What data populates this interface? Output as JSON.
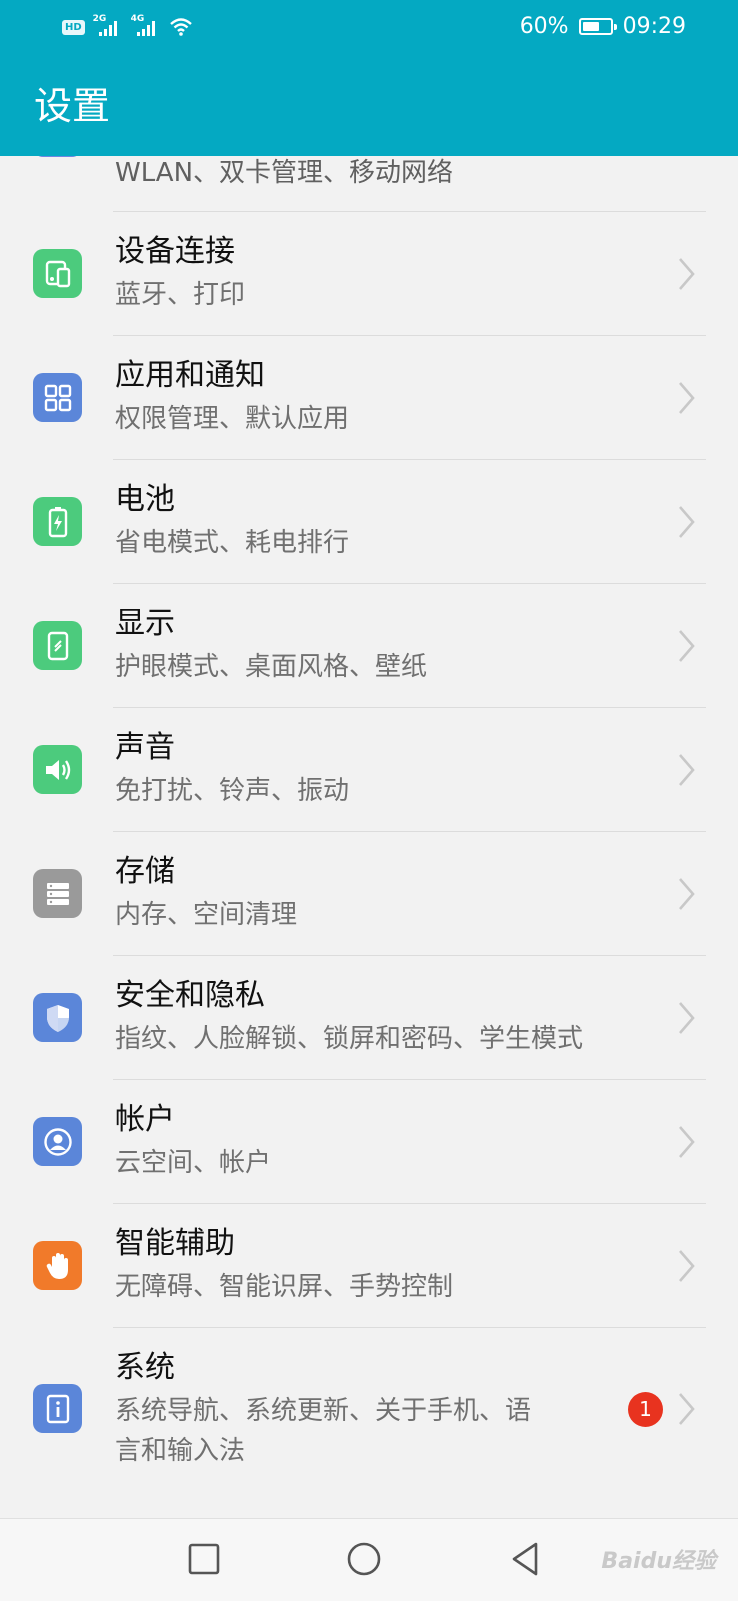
{
  "status_bar": {
    "hd": "HD",
    "sim1_network": "2G",
    "sim2_network": "4G",
    "battery_percent": "60%",
    "battery_level": 0.6,
    "time": "09:29"
  },
  "header": {
    "title": "设置"
  },
  "items": [
    {
      "title": "",
      "subtitle": "WLAN、双卡管理、移动网络",
      "icon": "network-icon",
      "color": "#6e86e3"
    },
    {
      "title": "设备连接",
      "subtitle": "蓝牙、打印",
      "icon": "device-connection-icon",
      "color": "#4ccb7d"
    },
    {
      "title": "应用和通知",
      "subtitle": "权限管理、默认应用",
      "icon": "apps-grid-icon",
      "color": "#5b86d9"
    },
    {
      "title": "电池",
      "subtitle": "省电模式、耗电排行",
      "icon": "battery-icon",
      "color": "#4ccb7d"
    },
    {
      "title": "显示",
      "subtitle": "护眼模式、桌面风格、壁纸",
      "icon": "display-icon",
      "color": "#4ccb7d"
    },
    {
      "title": "声音",
      "subtitle": "免打扰、铃声、振动",
      "icon": "sound-icon",
      "color": "#4ccb7d"
    },
    {
      "title": "存储",
      "subtitle": "内存、空间清理",
      "icon": "storage-icon",
      "color": "#9a9a9a"
    },
    {
      "title": "安全和隐私",
      "subtitle": "指纹、人脸解锁、锁屏和密码、学生模式",
      "icon": "shield-icon",
      "color": "#5b86d9"
    },
    {
      "title": "帐户",
      "subtitle": "云空间、帐户",
      "icon": "account-icon",
      "color": "#5b86d9"
    },
    {
      "title": "智能辅助",
      "subtitle": "无障碍、智能识屏、手势控制",
      "icon": "hand-icon",
      "color": "#f17a2a"
    },
    {
      "title": "系统",
      "subtitle": "系统导航、系统更新、关于手机、语",
      "subtitle2": "言和输入法",
      "icon": "info-icon",
      "color": "#5b86d9",
      "badge": "1"
    }
  ],
  "watermark": "Baidu经验"
}
